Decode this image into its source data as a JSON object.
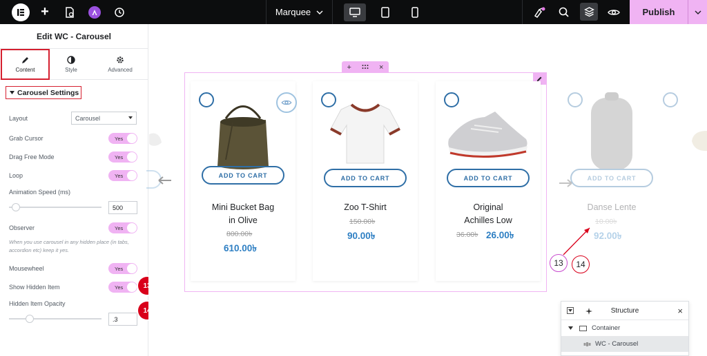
{
  "topbar": {
    "page_name": "Marquee",
    "publish_label": "Publish"
  },
  "panel": {
    "title": "Edit WC - Carousel",
    "tabs": [
      {
        "label": "Content"
      },
      {
        "label": "Style"
      },
      {
        "label": "Advanced"
      }
    ],
    "section_title": "Carousel Settings",
    "layout": {
      "label": "Layout",
      "value": "Carousel"
    },
    "grab_cursor": {
      "label": "Grab Cursor",
      "value": "Yes"
    },
    "drag_free": {
      "label": "Drag Free Mode",
      "value": "Yes"
    },
    "loop": {
      "label": "Loop",
      "value": "Yes"
    },
    "animation_speed": {
      "label": "Animation Speed (ms)",
      "value": "500"
    },
    "observer": {
      "label": "Observer",
      "value": "Yes"
    },
    "observer_note": "When you use carousel in any hidden place (in tabs, accordion etc) keep it yes.",
    "mousewheel": {
      "label": "Mousewheel",
      "value": "Yes"
    },
    "show_hidden": {
      "label": "Show Hidden Item",
      "value": "Yes"
    },
    "hidden_opacity": {
      "label": "Hidden Item Opacity",
      "value": ".3"
    }
  },
  "badges": {
    "b13": "13",
    "b14": "14"
  },
  "products": [
    {
      "name_line1": "Mini Bucket Bag",
      "name_line2": "in Olive",
      "old_price": "800.00৳",
      "new_price": "610.00৳",
      "cart_label": "ADD TO CART"
    },
    {
      "name_line1": "Zoo T-Shirt",
      "name_line2": "",
      "old_price": "150.00৳",
      "new_price": "90.00৳",
      "cart_label": "ADD TO CART"
    },
    {
      "name_line1": "Original",
      "name_line2": "Achilles Low",
      "old_price": "36.00৳",
      "new_price": "26.00৳",
      "cart_label": "ADD TO CART"
    },
    {
      "name_line1": "Danse Lente",
      "name_line2": "",
      "old_price": "10.00৳",
      "new_price": "92.00৳",
      "cart_label": "ADD TO CART"
    }
  ],
  "callouts": {
    "c13": "13",
    "c14": "14"
  },
  "structure": {
    "title": "Structure",
    "rows": [
      {
        "label": "Container"
      },
      {
        "label": "WC - Carousel"
      }
    ]
  },
  "colors": {
    "accent_pink": "#f0b3f3",
    "badge_red": "#d9001b",
    "price_blue": "#2e7fc3",
    "button_blue": "#2e6ea6"
  }
}
